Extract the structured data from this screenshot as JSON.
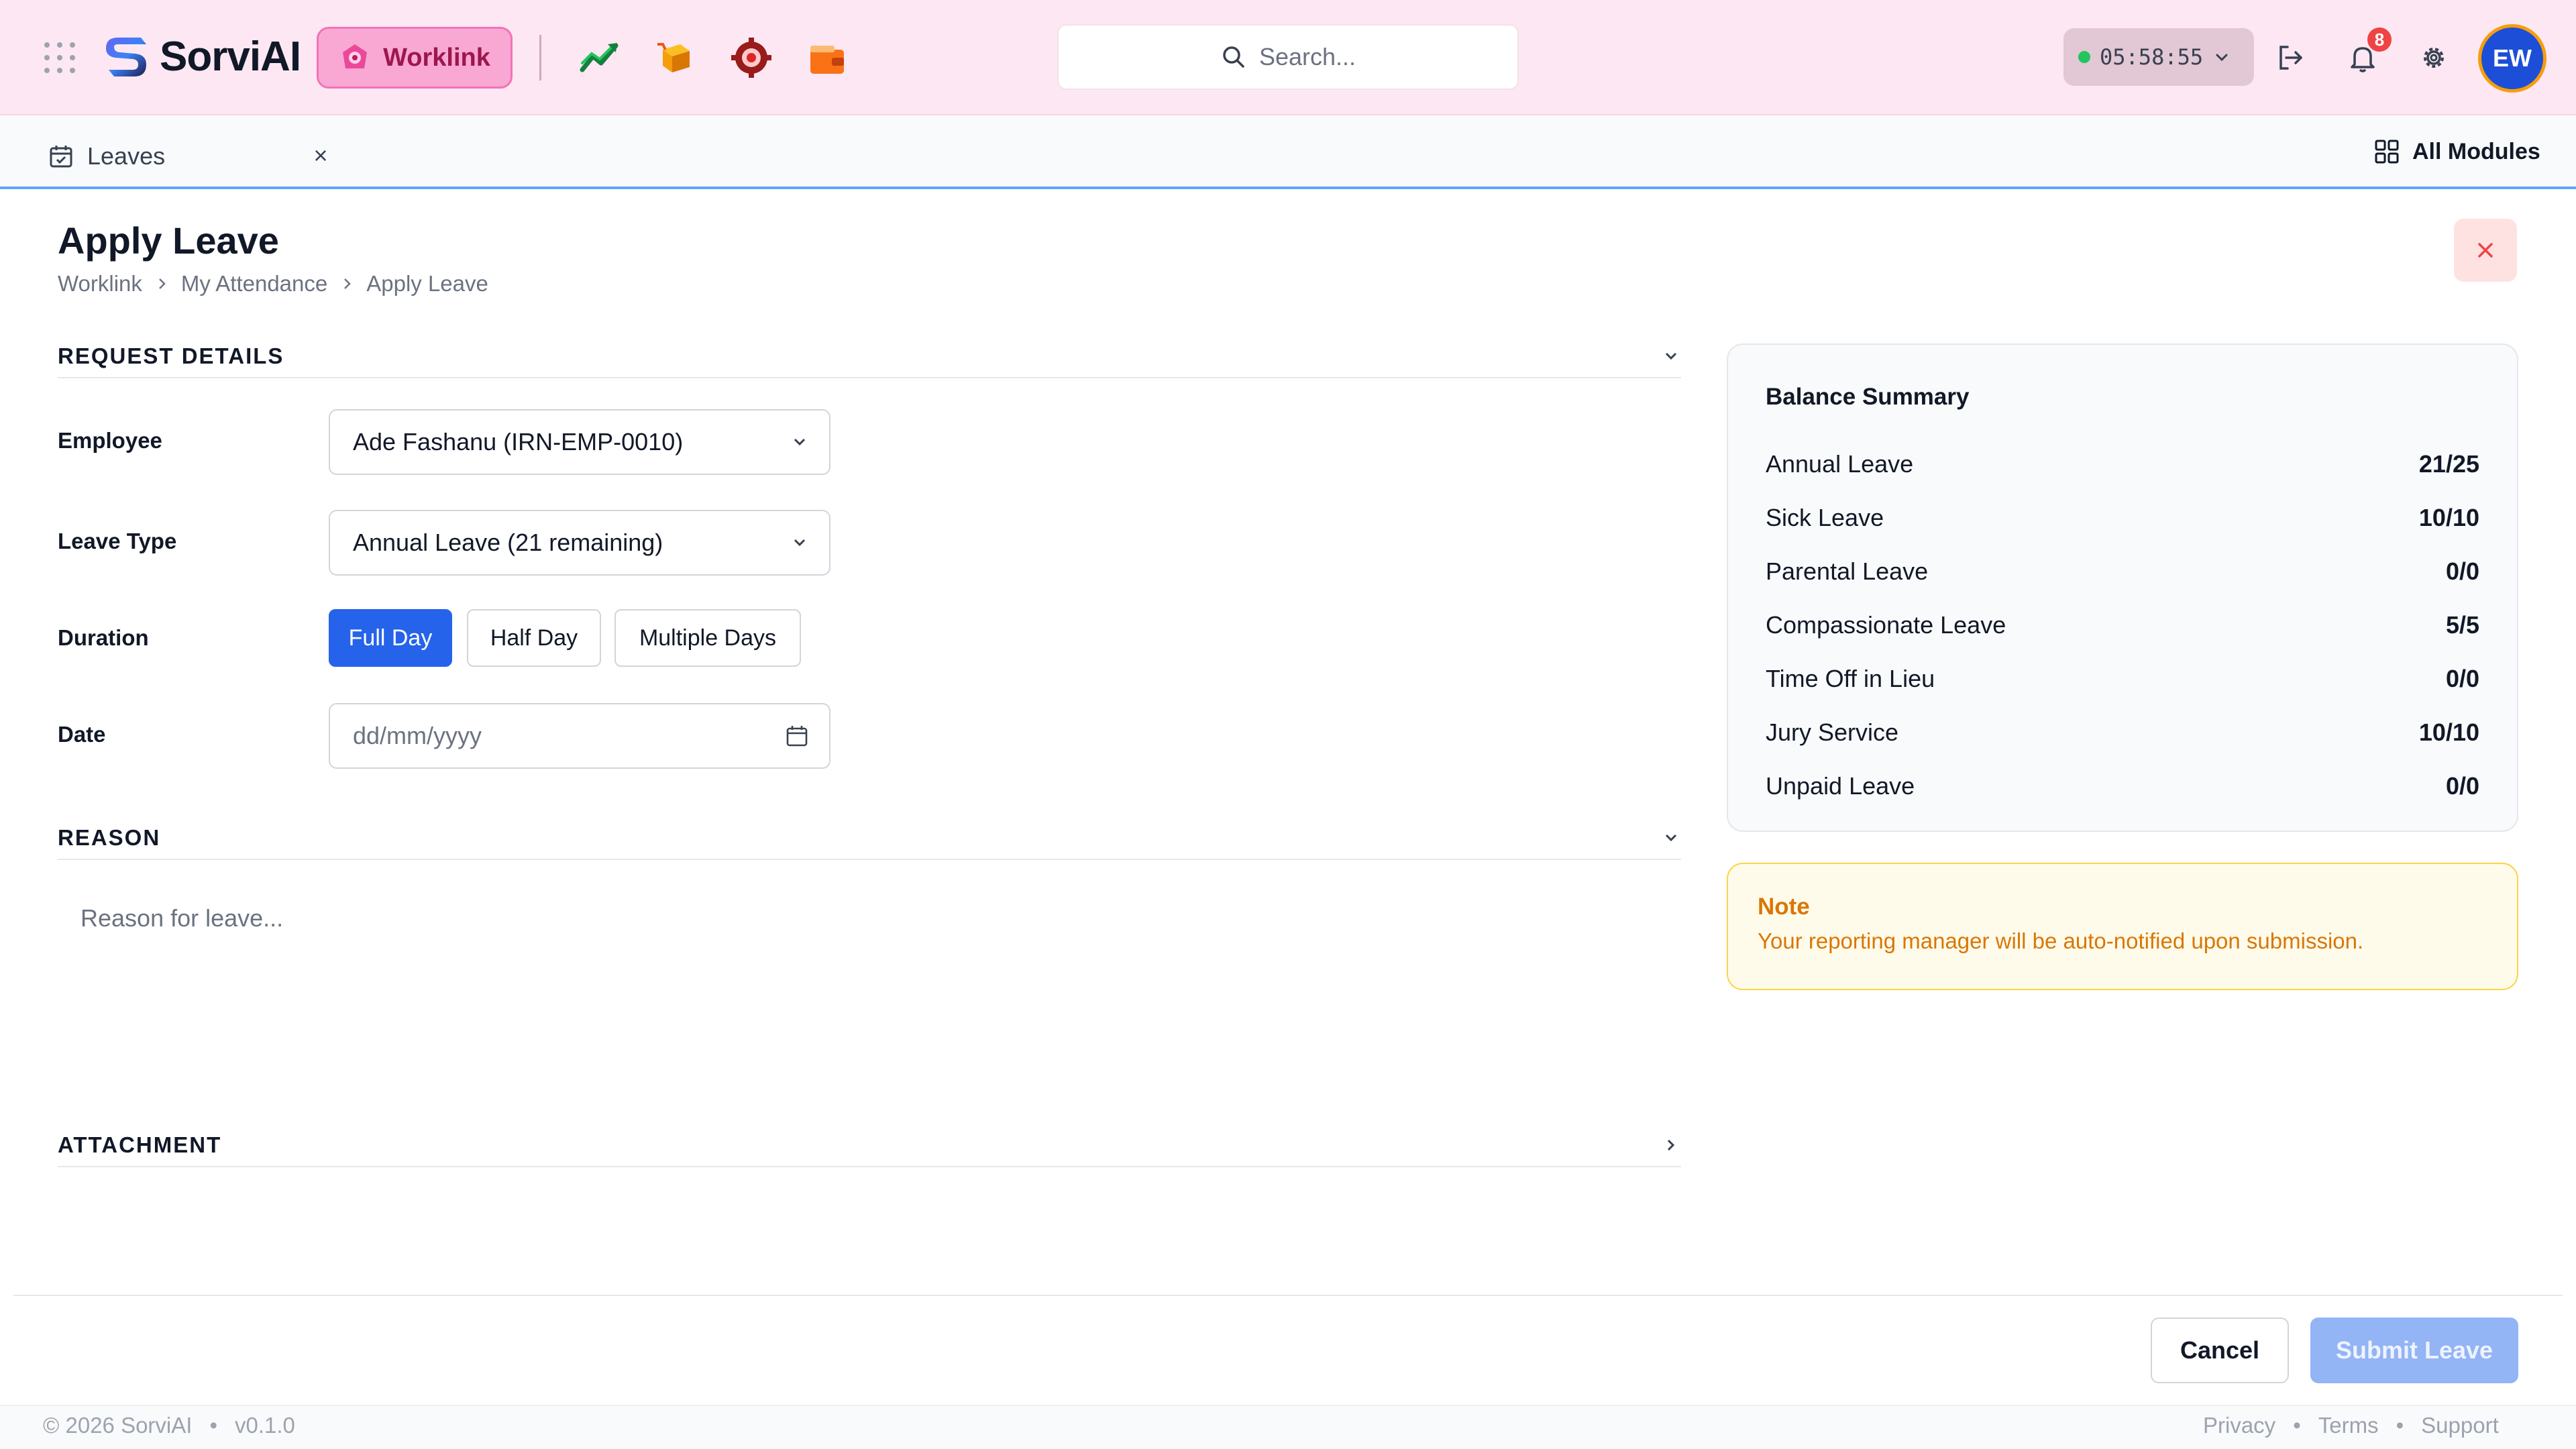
{
  "header": {
    "brand": "SorviAI",
    "active_module": "Worklink",
    "search_placeholder": "Search...",
    "timer": "05:58:55",
    "notification_count": "8",
    "avatar_initials": "EW",
    "apps": [
      "chart-icon",
      "package-icon",
      "gear-target-icon",
      "wallet-icon"
    ]
  },
  "tabs": {
    "active_tab": "Leaves",
    "all_modules": "All Modules"
  },
  "page": {
    "title": "Apply Leave",
    "breadcrumb": [
      "Worklink",
      "My Attendance",
      "Apply Leave"
    ]
  },
  "request_details": {
    "section_title": "REQUEST DETAILS",
    "employee_label": "Employee",
    "employee_value": "Ade Fashanu (IRN-EMP-0010)",
    "leave_type_label": "Leave Type",
    "leave_type_value": "Annual Leave (21 remaining)",
    "duration_label": "Duration",
    "duration_options": [
      "Full Day",
      "Half Day",
      "Multiple Days"
    ],
    "duration_selected": "Full Day",
    "date_label": "Date",
    "date_placeholder": "dd/mm/yyyy"
  },
  "reason": {
    "section_title": "REASON",
    "placeholder": "Reason for leave..."
  },
  "attachment": {
    "section_title": "ATTACHMENT"
  },
  "balance_summary": {
    "title": "Balance Summary",
    "rows": [
      {
        "name": "Annual Leave",
        "value": "21/25"
      },
      {
        "name": "Sick Leave",
        "value": "10/10"
      },
      {
        "name": "Parental Leave",
        "value": "0/0"
      },
      {
        "name": "Compassionate Leave",
        "value": "5/5"
      },
      {
        "name": "Time Off in Lieu",
        "value": "0/0"
      },
      {
        "name": "Jury Service",
        "value": "10/10"
      },
      {
        "name": "Unpaid Leave",
        "value": "0/0"
      }
    ]
  },
  "note": {
    "title": "Note",
    "text": "Your reporting manager will be auto-notified upon submission."
  },
  "actions": {
    "cancel": "Cancel",
    "submit": "Submit Leave"
  },
  "footer": {
    "copyright": "© 2026 SorviAI",
    "version": "v0.1.0",
    "links": [
      "Privacy",
      "Terms",
      "Support"
    ]
  },
  "colors": {
    "primary": "#2563eb",
    "header_bg": "#fce7f3",
    "worklink_accent": "#f472b6",
    "note_accent": "#d97706"
  }
}
